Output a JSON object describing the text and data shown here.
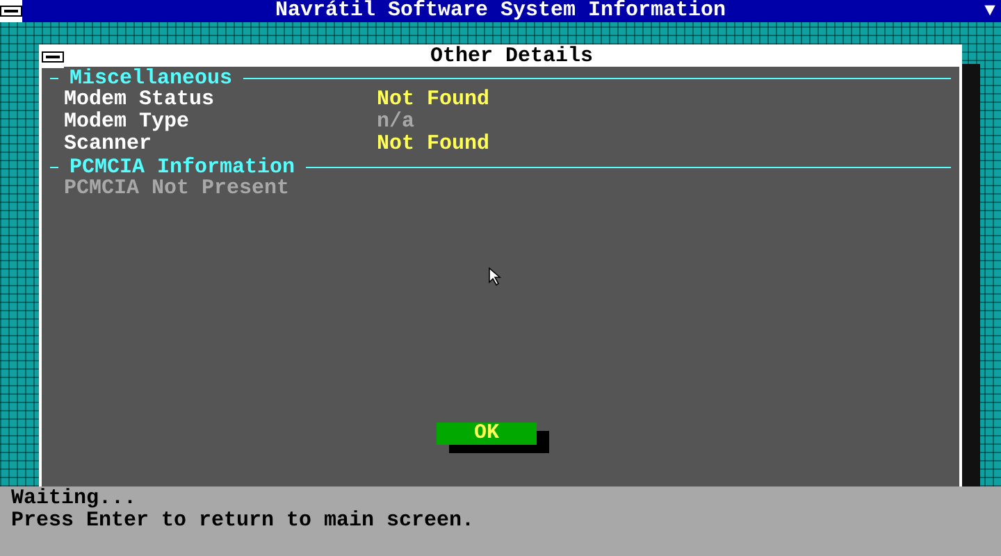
{
  "window": {
    "title": "Navrátil Software System Information",
    "menu_glyph": "▼"
  },
  "dialog": {
    "title": "Other Details",
    "items": [
      {
        "kind": "heading",
        "label": "Miscellaneous"
      },
      {
        "kind": "row",
        "label": "Modem Status",
        "value": "Not Found",
        "dimmed": false
      },
      {
        "kind": "row",
        "label": "Modem Type",
        "value": "n/a",
        "dimmed": true
      },
      {
        "kind": "row",
        "label": "Scanner",
        "value": "Not Found",
        "dimmed": false
      },
      {
        "kind": "heading",
        "label": "PCMCIA Information"
      },
      {
        "kind": "note",
        "label": "PCMCIA Not Present",
        "dimmed": true
      }
    ],
    "button": "OK"
  },
  "status_bar": [
    "Waiting...",
    "Press Enter to return to main screen."
  ]
}
